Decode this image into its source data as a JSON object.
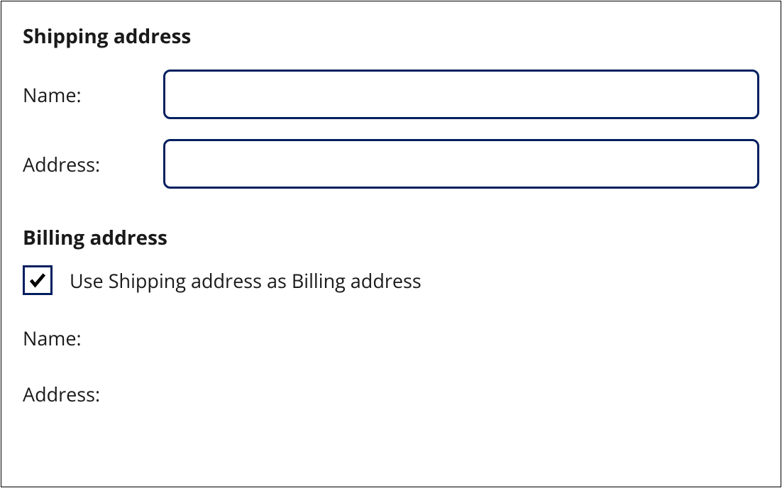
{
  "shipping": {
    "heading": "Shipping address",
    "name_label": "Name:",
    "name_value": "",
    "address_label": "Address:",
    "address_value": ""
  },
  "billing": {
    "heading": "Billing address",
    "use_shipping_label": "Use Shipping address as Billing address",
    "use_shipping_checked": true,
    "name_label": "Name:",
    "address_label": "Address:"
  }
}
